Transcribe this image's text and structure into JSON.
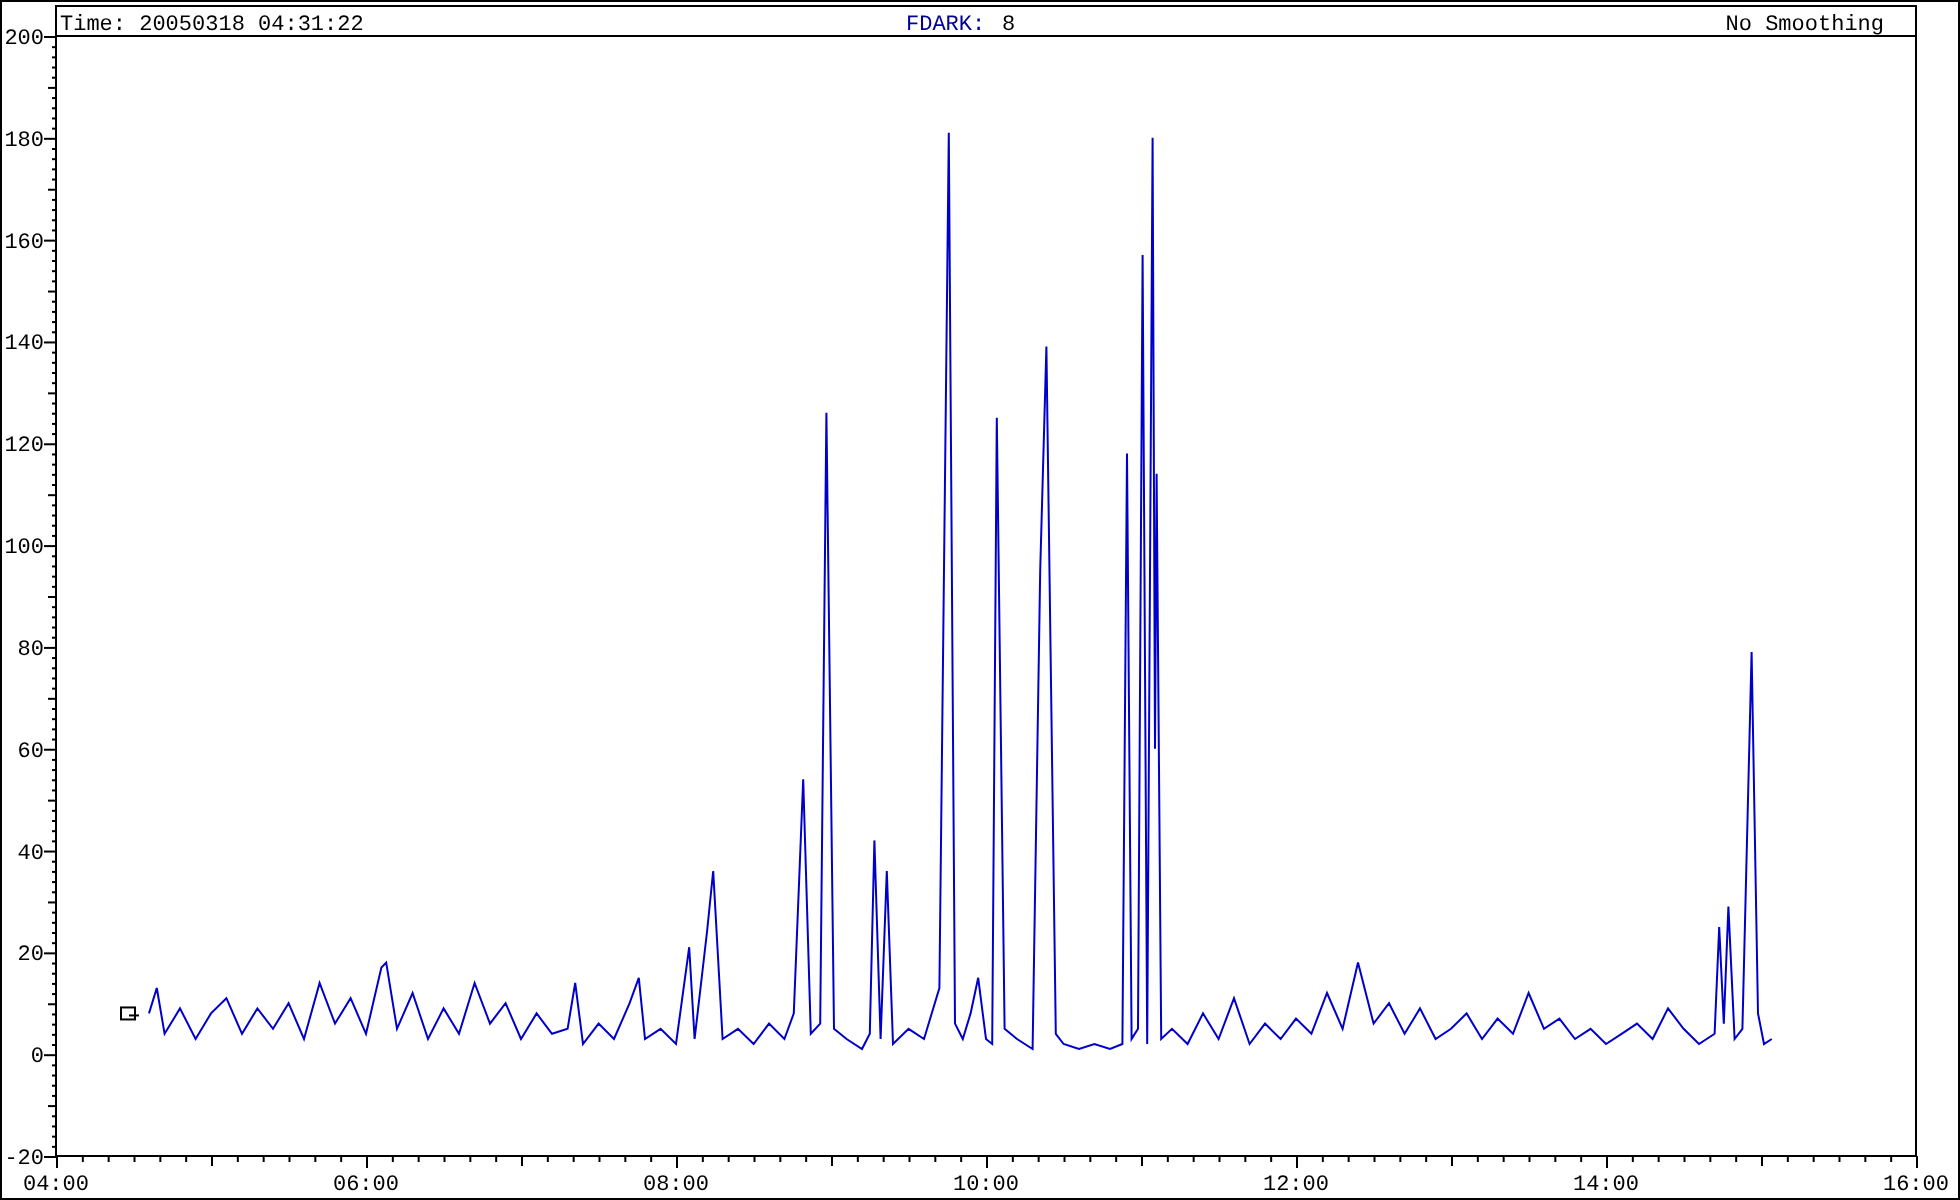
{
  "header": {
    "time": "Time: 20050318 04:31:22",
    "channel_label": "FDARK:",
    "channel_value": "8",
    "smoothing": "No Smoothing"
  },
  "chart_data": {
    "type": "line",
    "xlim": [
      4,
      16
    ],
    "ylim": [
      -20,
      200
    ],
    "xticks": [
      {
        "value": 4,
        "label": "04:00"
      },
      {
        "value": 6,
        "label": "06:00"
      },
      {
        "value": 8,
        "label": "08:00"
      },
      {
        "value": 10,
        "label": "10:00"
      },
      {
        "value": 12,
        "label": "12:00"
      },
      {
        "value": 14,
        "label": "14:00"
      },
      {
        "value": 16,
        "label": "16:00"
      }
    ],
    "yticks": [
      -20,
      0,
      20,
      40,
      60,
      80,
      100,
      120,
      140,
      160,
      180,
      200
    ],
    "x": [
      4.6,
      4.65,
      4.7,
      4.8,
      4.9,
      5.0,
      5.1,
      5.2,
      5.3,
      5.4,
      5.5,
      5.6,
      5.7,
      5.8,
      5.9,
      6.0,
      6.1,
      6.13,
      6.2,
      6.3,
      6.4,
      6.5,
      6.6,
      6.7,
      6.8,
      6.9,
      7.0,
      7.1,
      7.2,
      7.3,
      7.35,
      7.4,
      7.5,
      7.6,
      7.7,
      7.76,
      7.8,
      7.9,
      8.0,
      8.085,
      8.12,
      8.2,
      8.24,
      8.3,
      8.4,
      8.5,
      8.6,
      8.7,
      8.76,
      8.82,
      8.87,
      8.93,
      8.97,
      9.02,
      9.1,
      9.2,
      9.25,
      9.28,
      9.32,
      9.36,
      9.4,
      9.5,
      9.6,
      9.7,
      9.76,
      9.8,
      9.85,
      9.9,
      9.95,
      10.0,
      10.04,
      10.07,
      10.12,
      10.2,
      10.3,
      10.35,
      10.39,
      10.45,
      10.5,
      10.6,
      10.7,
      10.8,
      10.88,
      10.91,
      10.94,
      10.98,
      11.01,
      11.04,
      11.075,
      11.09,
      11.1,
      11.13,
      11.2,
      11.3,
      11.4,
      11.5,
      11.6,
      11.7,
      11.8,
      11.9,
      12.0,
      12.1,
      12.2,
      12.3,
      12.4,
      12.5,
      12.6,
      12.7,
      12.8,
      12.9,
      13.0,
      13.1,
      13.2,
      13.3,
      13.4,
      13.5,
      13.6,
      13.7,
      13.8,
      13.9,
      14.0,
      14.1,
      14.2,
      14.3,
      14.4,
      14.5,
      14.6,
      14.7,
      14.73,
      14.76,
      14.79,
      14.83,
      14.88,
      14.94,
      14.98,
      15.02,
      15.07
    ],
    "series": [
      {
        "color": "#0000cc",
        "values": [
          8,
          13,
          4,
          9,
          3,
          8,
          11,
          4,
          9,
          5,
          10,
          3,
          14,
          6,
          11,
          4,
          17,
          18,
          5,
          12,
          3,
          9,
          4,
          14,
          6,
          10,
          3,
          8,
          4,
          5,
          14,
          2,
          6,
          3,
          10,
          15,
          3,
          5,
          2,
          21,
          3,
          24,
          36,
          3,
          5,
          2,
          6,
          3,
          8,
          54,
          4,
          6,
          126,
          5,
          3,
          1,
          4,
          42,
          3,
          36,
          2,
          5,
          3,
          13,
          181,
          6,
          3,
          8,
          15,
          3,
          2,
          125,
          5,
          3,
          1,
          95,
          139,
          4,
          2,
          1,
          2,
          1,
          2,
          118,
          3,
          5,
          157,
          2,
          180,
          60,
          114,
          3,
          5,
          2,
          8,
          3,
          11,
          2,
          6,
          3,
          7,
          4,
          12,
          5,
          18,
          6,
          10,
          4,
          9,
          3,
          5,
          8,
          3,
          7,
          4,
          12,
          5,
          7,
          3,
          5,
          2,
          4,
          6,
          3,
          9,
          5,
          2,
          4,
          25,
          6,
          29,
          3,
          5,
          79,
          8,
          2,
          3
        ]
      }
    ]
  }
}
